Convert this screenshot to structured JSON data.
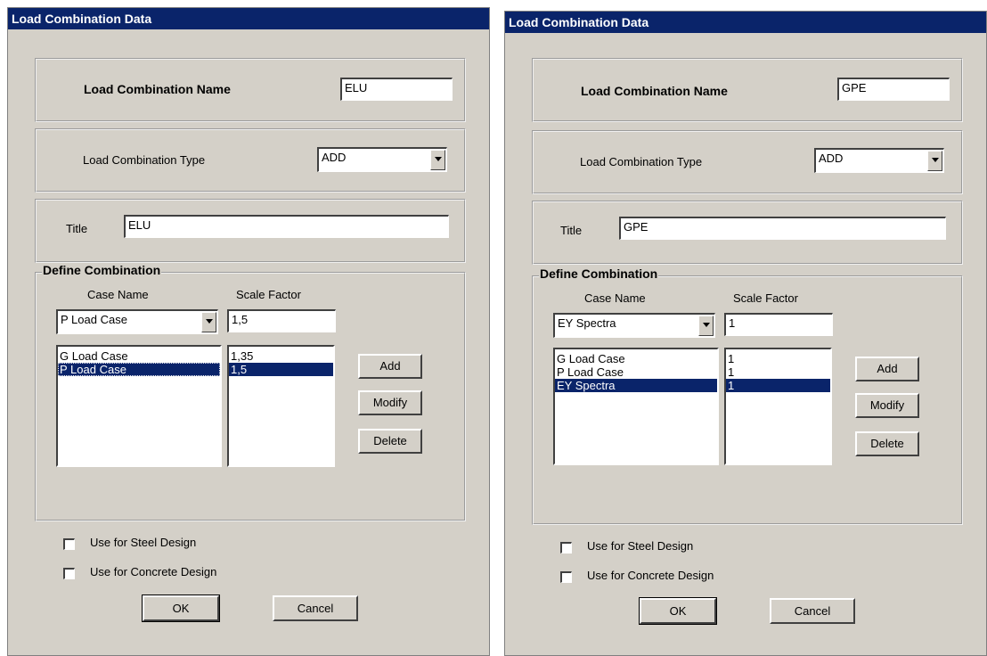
{
  "dialogs": [
    {
      "window_title": "Load Combination Data",
      "name_label": "Load Combination Name",
      "name_value": "ELU",
      "type_label": "Load Combination Type",
      "type_value": "ADD",
      "title_label": "Title",
      "title_value": "ELU",
      "define_label": "Define Combination",
      "case_name_header": "Case Name",
      "scale_factor_header": "Scale Factor",
      "case_select_value": "P Load Case",
      "scale_factor_value": "1,5",
      "cases": [
        "G Load Case",
        "P Load Case"
      ],
      "factors": [
        "1,35",
        "1,5"
      ],
      "selected_index": 1,
      "add_label": "Add",
      "modify_label": "Modify",
      "delete_label": "Delete",
      "steel_label": "Use for Steel Design",
      "concrete_label": "Use for Concrete Design",
      "ok_label": "OK",
      "cancel_label": "Cancel"
    },
    {
      "window_title": "Load Combination Data",
      "name_label": "Load Combination Name",
      "name_value": "GPE",
      "type_label": "Load Combination Type",
      "type_value": "ADD",
      "title_label": "Title",
      "title_value": "GPE",
      "define_label": "Define Combination",
      "case_name_header": "Case Name",
      "scale_factor_header": "Scale Factor",
      "case_select_value": "EY Spectra",
      "scale_factor_value": "1",
      "cases": [
        "G Load Case",
        "P Load Case",
        "EY Spectra"
      ],
      "factors": [
        "1",
        "1",
        "1"
      ],
      "selected_index": 2,
      "add_label": "Add",
      "modify_label": "Modify",
      "delete_label": "Delete",
      "steel_label": "Use for Steel Design",
      "concrete_label": "Use for Concrete Design",
      "ok_label": "OK",
      "cancel_label": "Cancel"
    }
  ]
}
